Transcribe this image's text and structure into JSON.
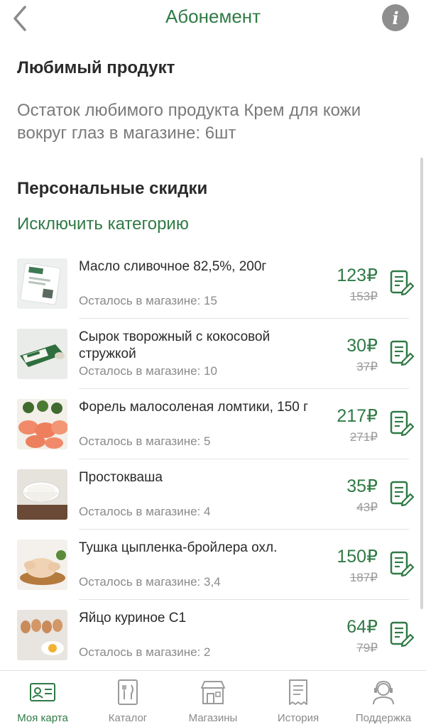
{
  "header": {
    "title": "Абонемент",
    "back_icon": "chevron-left-icon",
    "info_icon": "info-icon",
    "info_glyph": "i"
  },
  "favorite": {
    "title": "Любимый продукт",
    "text": "Остаток любимого продукта Крем для кожи вокруг глаз в магазине: 6шт"
  },
  "discounts": {
    "title": "Персональные скидки",
    "exclude_label": "Исключить категорию",
    "items": [
      {
        "name": "Масло сливочное 82,5%, 200г",
        "stock": "Осталось в магазине: 15",
        "price": "123₽",
        "old_price": "153₽",
        "image": "butter-pack"
      },
      {
        "name": "Сырок творожный с кокосовой стружкой",
        "stock": "Осталось в магазине: 10",
        "price": "30₽",
        "old_price": "37₽",
        "image": "curd-bar"
      },
      {
        "name": "Форель малосоленая ломтики, 150 г",
        "stock": "Осталось в магазине: 5",
        "price": "217₽",
        "old_price": "271₽",
        "image": "trout-slices"
      },
      {
        "name": "Простокваша",
        "stock": "Осталось в магазине: 4",
        "price": "35₽",
        "old_price": "43₽",
        "image": "yogurt-bowl"
      },
      {
        "name": "Тушка цыпленка-бройлера охл.",
        "stock": "Осталось в магазине: 3,4",
        "price": "150₽",
        "old_price": "187₽",
        "image": "chicken"
      },
      {
        "name": "Яйцо куриное С1",
        "stock": "Осталось в магазине: 2",
        "price": "64₽",
        "old_price": "79₽",
        "image": "eggs"
      }
    ]
  },
  "tabbar": {
    "tabs": [
      {
        "label": "Моя карта",
        "icon": "card-icon",
        "active": true
      },
      {
        "label": "Каталог",
        "icon": "catalog-icon",
        "active": false
      },
      {
        "label": "Магазины",
        "icon": "store-icon",
        "active": false
      },
      {
        "label": "История",
        "icon": "history-icon",
        "active": false
      },
      {
        "label": "Поддержка",
        "icon": "support-icon",
        "active": false
      }
    ]
  },
  "colors": {
    "accent": "#2f7a45",
    "muted": "#8a8a8a",
    "info_bg": "#8e8e8e"
  }
}
